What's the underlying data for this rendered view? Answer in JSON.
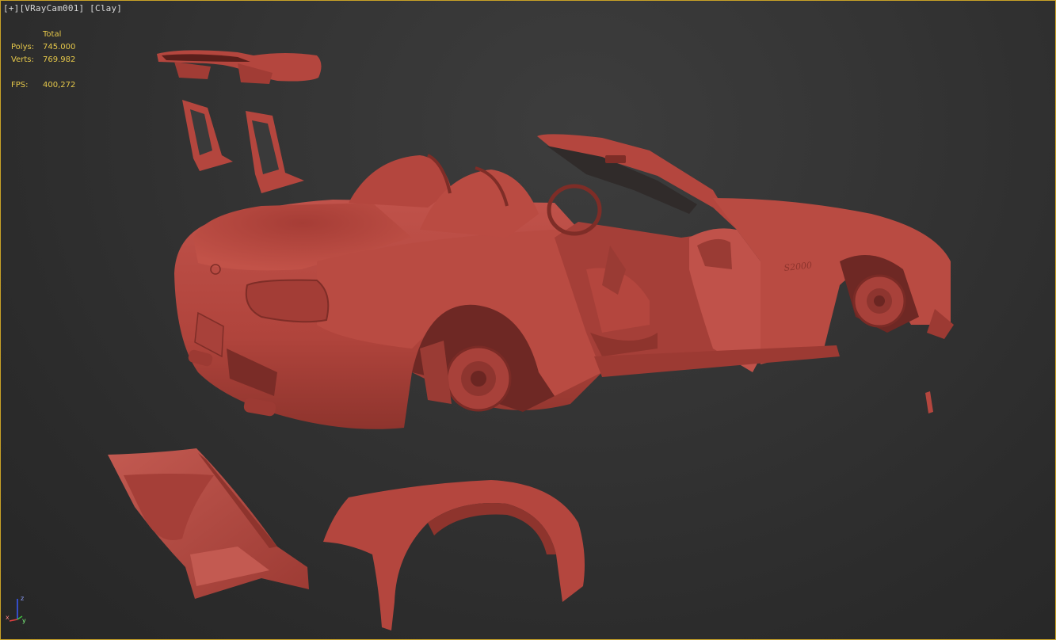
{
  "viewport": {
    "plus": "[+]",
    "camera": "[VRayCam001]",
    "shading": "[Clay]"
  },
  "stats": {
    "header": "Total",
    "polys_label": "Polys:",
    "polys_value": "745.000",
    "verts_label": "Verts:",
    "verts_value": "769.982",
    "fps_label": "FPS:",
    "fps_value": "400,272"
  },
  "gizmo": {
    "z": "z",
    "x": "x",
    "y": "y"
  },
  "colors": {
    "clay": "#b4463e",
    "clay_dark": "#7e2d27",
    "clay_light": "#c95a50",
    "frame": "#c9a227",
    "stats": "#e6c84a"
  }
}
